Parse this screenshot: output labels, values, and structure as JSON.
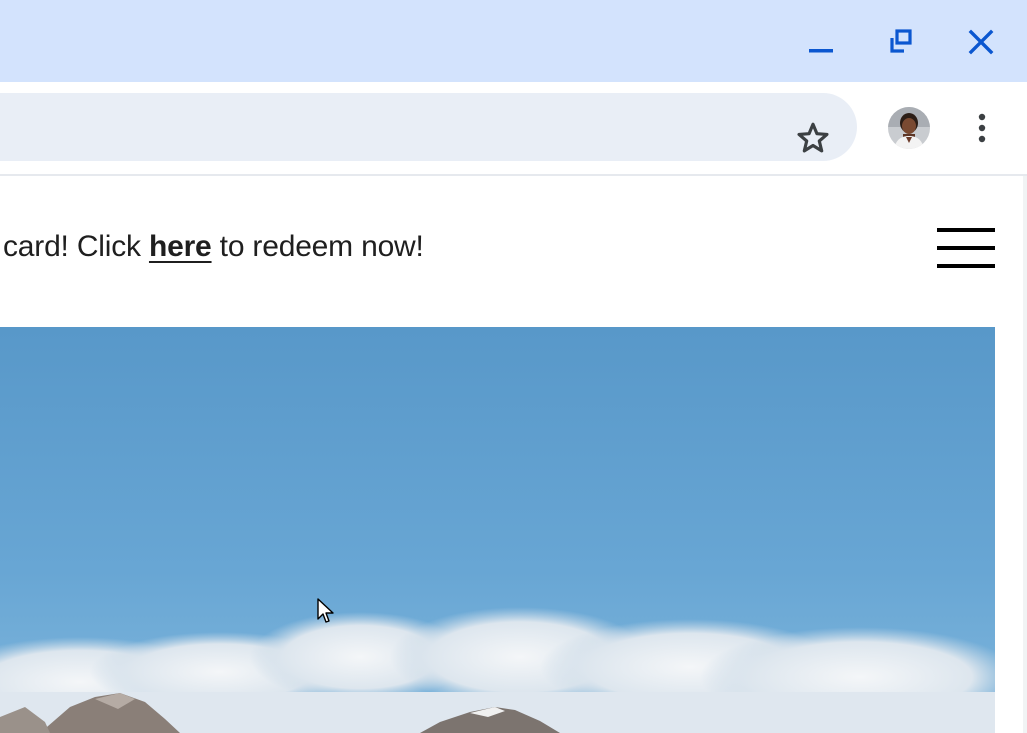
{
  "window_controls": {
    "minimize_icon": "minimize-icon",
    "restore_icon": "restore-icon",
    "close_icon": "close-icon",
    "accent_color": "#0b57d0"
  },
  "toolbar": {
    "bookmark_icon": "star-icon",
    "profile_icon": "avatar",
    "menu_icon": "kebab-menu-icon"
  },
  "page": {
    "banner": {
      "text_before": "card! Click ",
      "link_text": "here",
      "text_after": " to redeem now!"
    },
    "menu_icon": "hamburger-icon",
    "hero_image": "mountains-under-blue-sky"
  },
  "colors": {
    "titlebar": "#d3e3fd",
    "omnibox": "#e9eef6",
    "sky": "#5fa0cf"
  }
}
